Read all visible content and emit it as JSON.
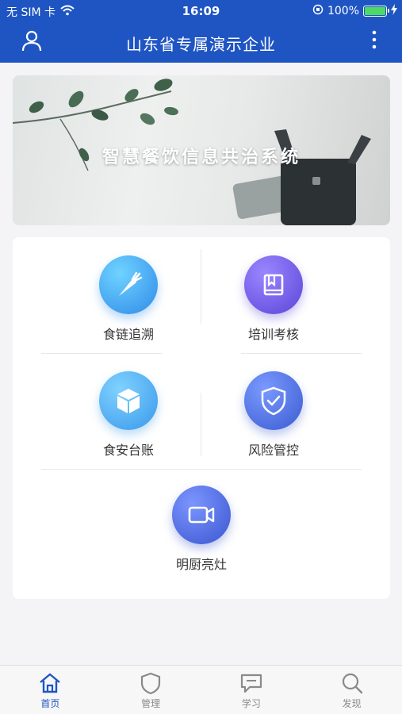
{
  "status_bar": {
    "carrier": "无 SIM 卡",
    "time": "16:09",
    "battery": "100%"
  },
  "header": {
    "title": "山东省专属演示企业"
  },
  "banner": {
    "title": "智慧餐饮信息共治系统"
  },
  "tiles": [
    {
      "label": "食链追溯",
      "icon": "carrot-icon"
    },
    {
      "label": "培训考核",
      "icon": "book-icon"
    },
    {
      "label": "食安台账",
      "icon": "box-icon"
    },
    {
      "label": "风险管控",
      "icon": "shield-check-icon"
    },
    {
      "label": "明厨亮灶",
      "icon": "video-camera-icon"
    }
  ],
  "tabbar": {
    "items": [
      {
        "label": "首页",
        "icon": "home-icon",
        "active": true
      },
      {
        "label": "管理",
        "icon": "shield-icon",
        "active": false
      },
      {
        "label": "学习",
        "icon": "chat-icon",
        "active": false
      },
      {
        "label": "发现",
        "icon": "search-icon",
        "active": false
      }
    ]
  },
  "colors": {
    "primary": "#1f55c3",
    "background": "#f4f3f5",
    "battery": "#4cd964"
  }
}
